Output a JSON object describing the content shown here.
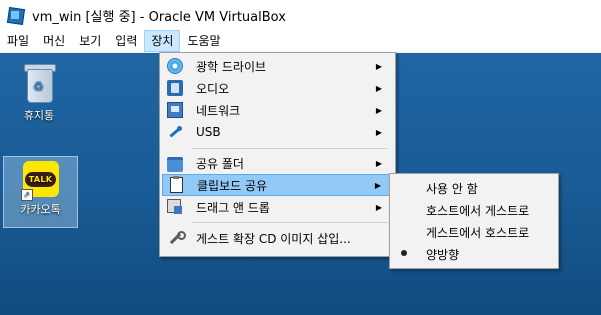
{
  "window": {
    "title": "vm_win [실행 중] - Oracle VM VirtualBox"
  },
  "menubar": [
    {
      "label": "파일"
    },
    {
      "label": "머신"
    },
    {
      "label": "보기"
    },
    {
      "label": "입력"
    },
    {
      "label": "장치",
      "active": true
    },
    {
      "label": "도움말"
    }
  ],
  "desktop": {
    "recycle_bin": "휴지통",
    "kakaotalk": "카카오톡",
    "kakaotalk_logo_text": "TALK"
  },
  "devices_menu": {
    "items": [
      {
        "label": "광학 드라이브",
        "icon": "optical-drive-icon",
        "submenu": true
      },
      {
        "label": "오디오",
        "icon": "audio-icon",
        "submenu": true
      },
      {
        "label": "네트워크",
        "icon": "network-icon",
        "submenu": true
      },
      {
        "label": "USB",
        "icon": "usb-icon",
        "submenu": true
      },
      {
        "label": "공유 폴더",
        "icon": "shared-folder-icon",
        "submenu": true
      },
      {
        "label": "클립보드 공유",
        "icon": "clipboard-icon",
        "submenu": true,
        "highlighted": true
      },
      {
        "label": "드래그 앤 드롭",
        "icon": "drag-drop-icon",
        "submenu": true
      },
      {
        "label": "게스트 확장 CD 이미지 삽입...",
        "icon": "wrench-icon",
        "submenu": false
      }
    ]
  },
  "clipboard_submenu": {
    "items": [
      {
        "label": "사용 안 함",
        "selected": false
      },
      {
        "label": "호스트에서 게스트로",
        "selected": false
      },
      {
        "label": "게스트에서 호스트로",
        "selected": false
      },
      {
        "label": "양방향",
        "selected": true
      }
    ]
  },
  "colors": {
    "highlight": "#91c9f7",
    "menubar_active": "#cce8ff",
    "desktop": "#1c5a8f"
  }
}
